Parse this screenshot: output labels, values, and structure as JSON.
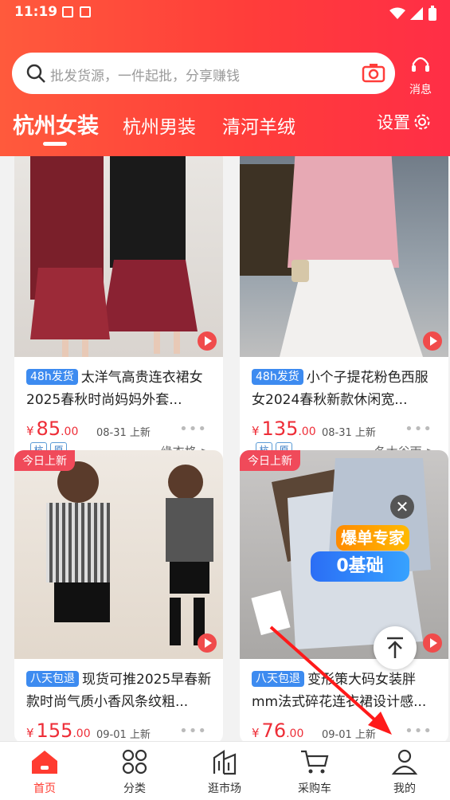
{
  "status": {
    "time": "11:19"
  },
  "search": {
    "placeholder": "批发货源，一件起批，分享赚钱"
  },
  "header": {
    "messages_label": "消息",
    "settings_label": "设置"
  },
  "tabs": [
    {
      "label": "杭州女装",
      "active": true
    },
    {
      "label": "杭州男装",
      "active": false
    },
    {
      "label": "清河羊绒",
      "active": false
    }
  ],
  "products": [
    {
      "badge": "48h发货",
      "title": "太洋气高贵连衣裙女2025春秋时尚妈妈外套...",
      "price_int": "85",
      "price_dec": ".00",
      "yen": "¥",
      "date": "08-31 上新",
      "tags": [
        "杭",
        "原"
      ],
      "store": "缘衣格 >"
    },
    {
      "badge": "48h发货",
      "title": "小个子提花粉色西服女2024春秋新款休闲宽...",
      "price_int": "135",
      "price_dec": ".00",
      "yen": "¥",
      "date": "08-31 上新",
      "tags": [
        "杭",
        "原"
      ],
      "store": "冬木谷雨 >"
    },
    {
      "top_tag": "今日上新",
      "badge": "八天包退",
      "title": "现货可推2025早春新款时尚气质小香风条纹粗...",
      "price_int": "155",
      "price_dec": ".00",
      "yen": "¥",
      "date": "09-01 上新"
    },
    {
      "top_tag": "今日上新",
      "badge": "八天包退",
      "title": "变形策大码女装胖mm法式碎花连衣裙设计感...",
      "price_int": "76",
      "price_dec": ".00",
      "yen": "¥",
      "date": "09-01 上新"
    }
  ],
  "promo": {
    "line1": "爆单专家",
    "line2": "0基础"
  },
  "bottom_nav": [
    {
      "label": "首页",
      "active": true
    },
    {
      "label": "分类"
    },
    {
      "label": "逛市场"
    },
    {
      "label": "采购车"
    },
    {
      "label": "我的"
    }
  ],
  "colors": {
    "brand_red": "#ff3d3a",
    "price_red": "#ee2d37",
    "badge_blue": "#3d8bf0"
  }
}
